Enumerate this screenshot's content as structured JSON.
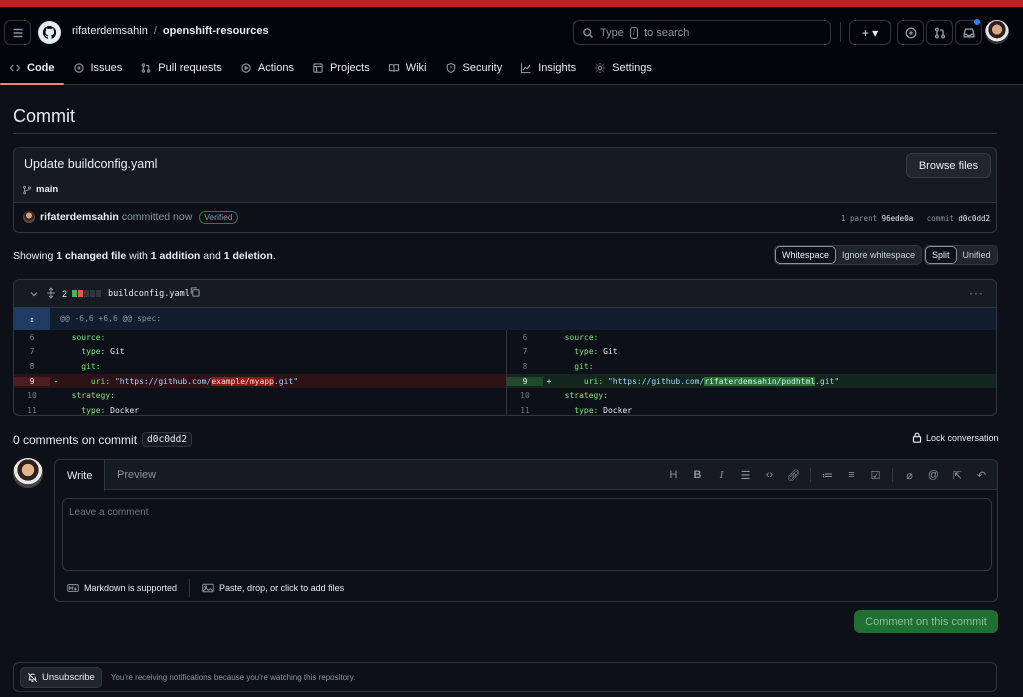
{
  "header": {
    "owner": "rifaterdemsahin",
    "separator": "/",
    "repo": "openshift-resources",
    "search_placeholder_a": "Type",
    "search_key": "/",
    "search_placeholder_b": "to search",
    "plus_label": "+ ▾"
  },
  "nav": {
    "tabs": [
      {
        "label": "Code"
      },
      {
        "label": "Issues"
      },
      {
        "label": "Pull requests"
      },
      {
        "label": "Actions"
      },
      {
        "label": "Projects"
      },
      {
        "label": "Wiki"
      },
      {
        "label": "Security"
      },
      {
        "label": "Insights"
      },
      {
        "label": "Settings"
      }
    ]
  },
  "page": {
    "title": "Commit"
  },
  "commit": {
    "message": "Update buildconfig.yaml",
    "branch": "main",
    "browse_label": "Browse files",
    "author": "rifaterdemsahin",
    "action": "committed now",
    "verified": "Verified",
    "parent_label": "1 parent",
    "parent_sha": "96ede0a",
    "commit_label": "commit",
    "commit_sha": "d0c0dd2"
  },
  "summary": {
    "prefix": "Showing",
    "files": "1 changed file",
    "with": "with",
    "additions": "1 addition",
    "and": "and",
    "deletions": "1 deletion",
    "end": "."
  },
  "view_options": {
    "whitespace": "Whitespace",
    "ignore_whitespace": "Ignore whitespace",
    "split": "Split",
    "unified": "Unified"
  },
  "file": {
    "change_count": "2",
    "name": "buildconfig.yaml",
    "hunk_header": "@@ -6,6 +6,6 @@ spec:",
    "left": [
      {
        "n": "6",
        "mark": "",
        "key": "source:",
        "indent": "  ",
        "rest": ""
      },
      {
        "n": "7",
        "mark": "",
        "key": "type:",
        "indent": "    ",
        "rest": " Git"
      },
      {
        "n": "8",
        "mark": "",
        "key": "git:",
        "indent": "    ",
        "rest": ""
      },
      {
        "n": "9",
        "mark": "-",
        "key": "uri:",
        "indent": "      ",
        "rest": ""
      },
      {
        "n": "10",
        "mark": "",
        "key": "strategy:",
        "indent": "  ",
        "rest": ""
      },
      {
        "n": "11",
        "mark": "",
        "key": "type:",
        "indent": "    ",
        "rest": " Docker"
      }
    ],
    "right": [
      {
        "n": "6",
        "mark": "",
        "key": "source:",
        "indent": "  ",
        "rest": ""
      },
      {
        "n": "7",
        "mark": "",
        "key": "type:",
        "indent": "    ",
        "rest": " Git"
      },
      {
        "n": "8",
        "mark": "",
        "key": "git:",
        "indent": "    ",
        "rest": ""
      },
      {
        "n": "9",
        "mark": "+",
        "key": "uri:",
        "indent": "      ",
        "rest": ""
      },
      {
        "n": "10",
        "mark": "",
        "key": "strategy:",
        "indent": "  ",
        "rest": ""
      },
      {
        "n": "11",
        "mark": "",
        "key": "type:",
        "indent": "    ",
        "rest": " Docker"
      }
    ],
    "del_uri_pre": " \"https://github.com/",
    "del_uri_hl": "example/myapp",
    "del_uri_post": ".git\"",
    "add_uri_pre": " \"https://github.com/",
    "add_uri_hl": "rifaterdemsahin/podhtml",
    "add_uri_post": ".git\""
  },
  "comments": {
    "title": "0 comments on commit",
    "sha": "d0c0dd2",
    "lock_label": "Lock conversation",
    "write_tab": "Write",
    "preview_tab": "Preview",
    "placeholder": "Leave a comment",
    "markdown_note": "Markdown is supported",
    "attach_note": "Paste, drop, or click to add files",
    "submit_label": "Comment on this commit"
  },
  "notifications": {
    "button": "Unsubscribe",
    "message": "You're receiving notifications because you're watching this repository."
  },
  "colors": {
    "accent": "#f78166",
    "add": "#3fb950",
    "del": "#f85149",
    "button_green": "#238636"
  }
}
